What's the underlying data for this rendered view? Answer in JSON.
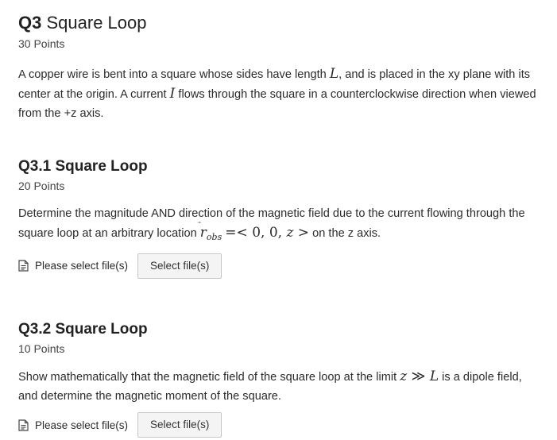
{
  "q3": {
    "number": "Q3",
    "title": "Square Loop",
    "points": "30 Points",
    "description": {
      "t1": "A copper wire is bent into a square whose sides have length ",
      "L": "L",
      "t2": ", and is placed in the xy plane with its center at the origin. A current ",
      "I": "I",
      "t3": " flows through the square in a counterclockwise direction when viewed from the +z axis."
    }
  },
  "q3_1": {
    "number": "Q3.1",
    "title": "Square Loop",
    "points": "20 Points",
    "prompt": {
      "t1": "Determine the magnitude AND direction of the magnetic field due to the current flowing through the square loop at an arbitrary location ",
      "r": "r",
      "arrow": "⃗",
      "sub": "obs",
      "eq": "=< 0, 0, ",
      "z": "z",
      "close": " >",
      "t2": " on the z axis."
    },
    "upload_label": "Please select file(s)",
    "button_label": "Select file(s)"
  },
  "q3_2": {
    "number": "Q3.2",
    "title": "Square Loop",
    "points": "10 Points",
    "prompt": {
      "t1": "Show mathematically that the magnetic field of the square loop at the limit ",
      "z": "z",
      "gg": " ≫ ",
      "L": "L",
      "t2": " is a dipole field, and determine the magnetic moment of the square."
    },
    "upload_label": "Please select file(s)",
    "button_label": "Select file(s)"
  }
}
